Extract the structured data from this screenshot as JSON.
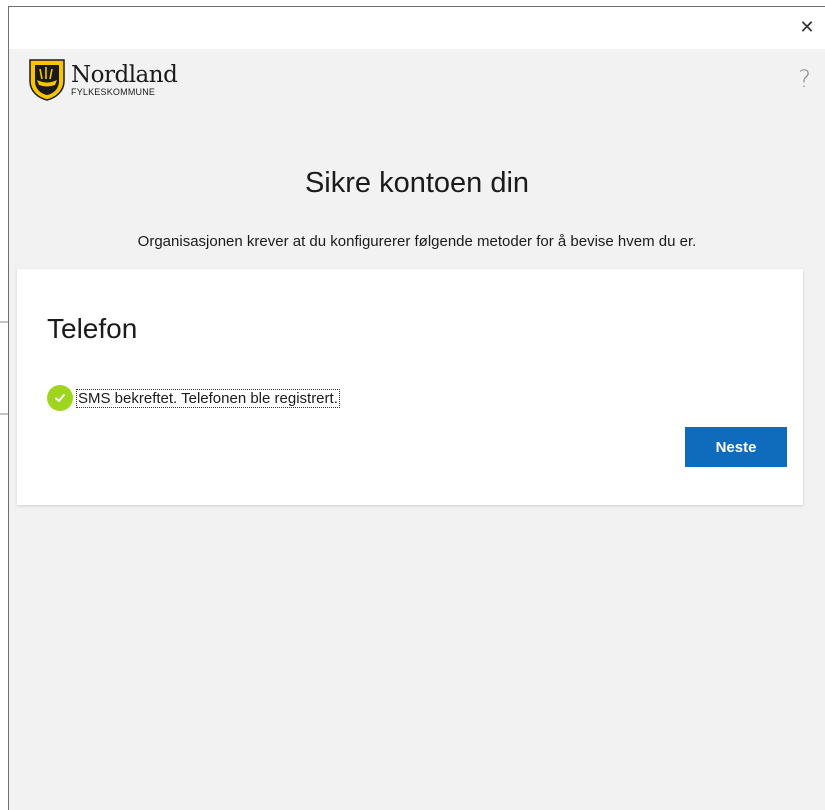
{
  "window": {
    "close_glyph": "✕"
  },
  "header": {
    "logo_name": "Nordland",
    "logo_subtitle": "FYLKESKOMMUNE",
    "help_glyph": "?"
  },
  "page": {
    "title": "Sikre kontoen din",
    "subtitle": "Organisasjonen krever at du konfigurerer følgende metoder for å bevise hvem du er."
  },
  "card": {
    "title": "Telefon",
    "status_text": "SMS bekreftet. Telefonen ble registrert.",
    "next_label": "Neste"
  },
  "colors": {
    "accent": "#0f6cbd",
    "success": "#9fd51f",
    "background": "#f2f2f2",
    "logo_yellow": "#f7c600"
  },
  "icons": {
    "close": "close-icon",
    "help": "help-icon",
    "status": "checkmark-circle-icon",
    "logo": "nordland-shield-icon"
  }
}
